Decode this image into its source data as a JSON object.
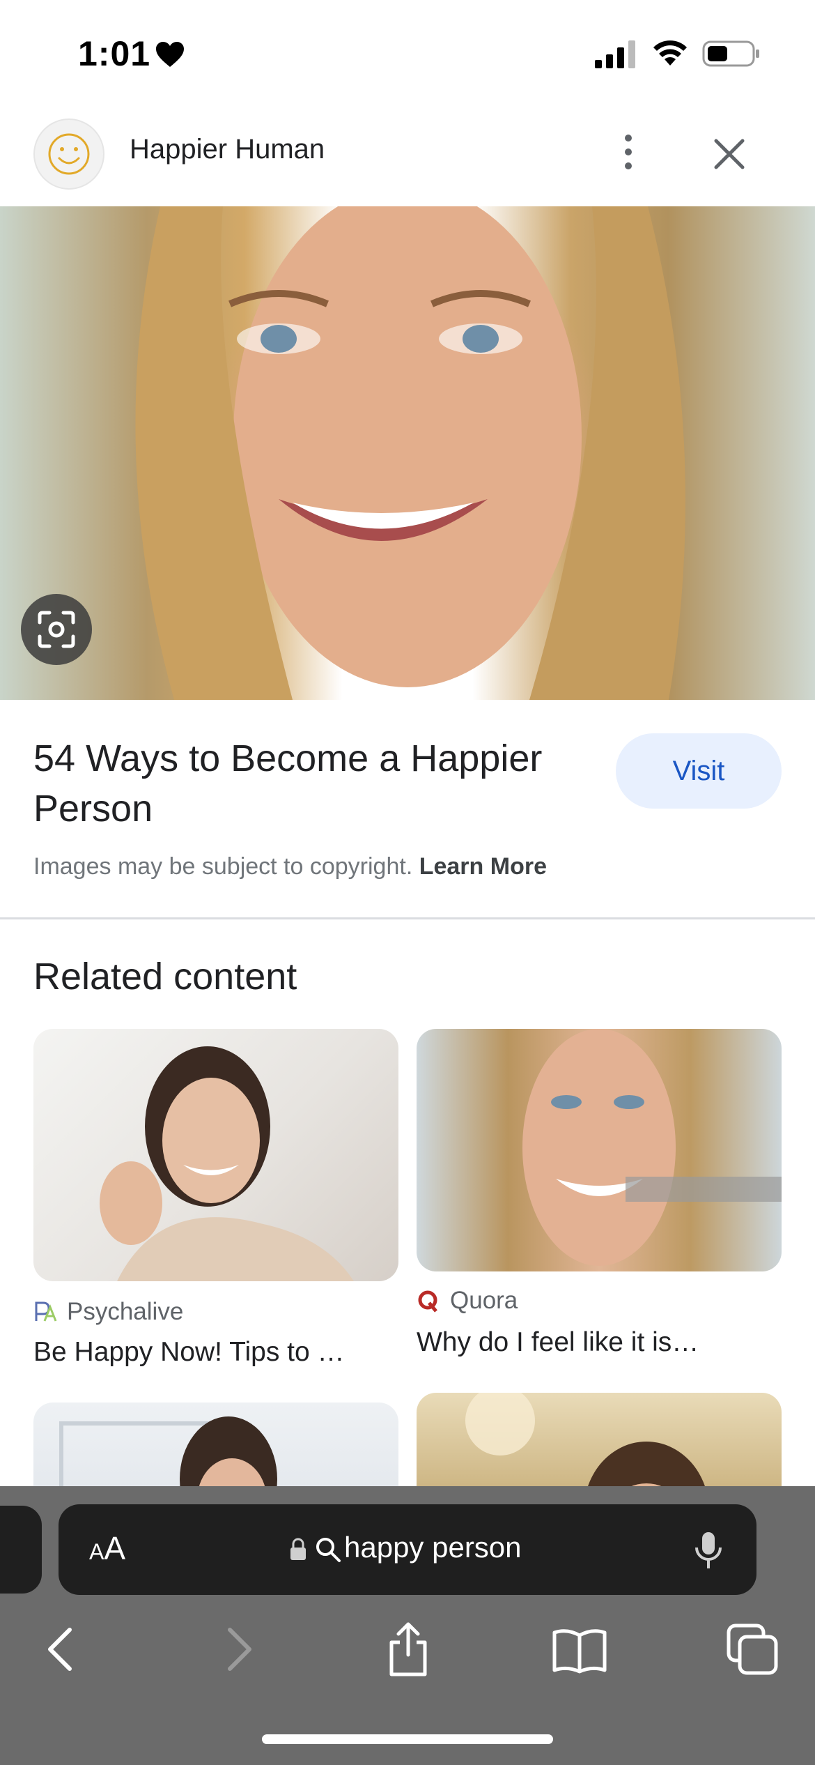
{
  "status_bar": {
    "time": "1:01",
    "icons": [
      "heart-icon",
      "signal-icon",
      "wifi-icon",
      "battery-icon"
    ]
  },
  "header": {
    "site_name": "Happier Human",
    "avatar_icon": "smiley-icon",
    "actions": [
      "more-icon",
      "close-icon"
    ]
  },
  "result": {
    "title": "54 Ways to Become a Happier Person",
    "visit_label": "Visit",
    "copyright_text": "Images may be subject to copyright.",
    "learn_more": "Learn More"
  },
  "related": {
    "heading": "Related content",
    "cards": [
      {
        "source": "Psychalive",
        "title": "Be Happy Now! Tips to …"
      },
      {
        "source": "Quora",
        "title": "Why do I feel like it is…"
      }
    ]
  },
  "browser": {
    "aa_small": "A",
    "aa_large": "A",
    "address": "happy person",
    "nav": [
      "back-icon",
      "forward-icon",
      "share-icon",
      "bookmarks-icon",
      "tabs-icon"
    ]
  },
  "colors": {
    "visit_bg": "#e8f0fe",
    "visit_text": "#1a56c4",
    "toolbar": "#6b6b6b",
    "address_bar": "#1f1f1f"
  }
}
